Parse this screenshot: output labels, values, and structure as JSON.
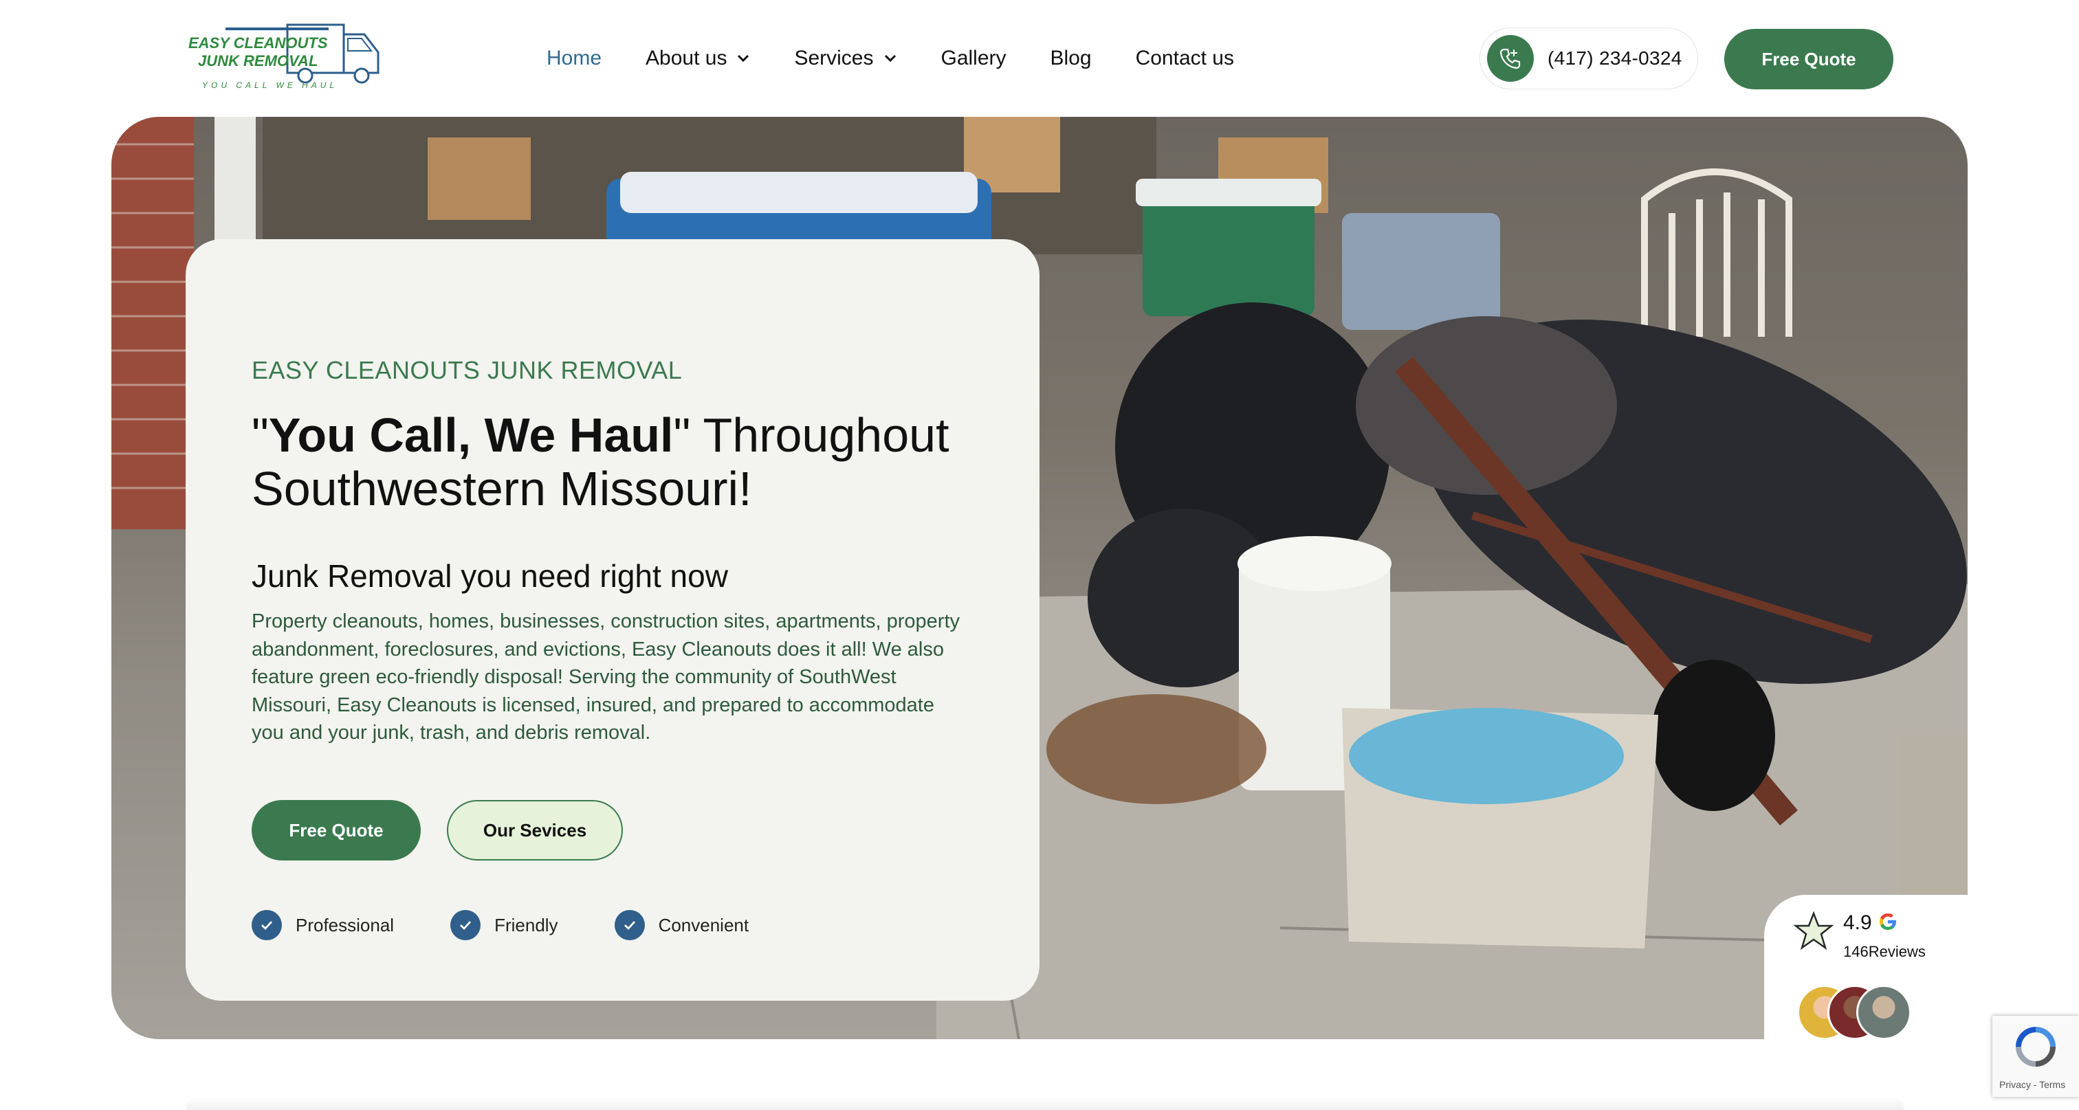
{
  "logo": {
    "line1": "EASY CLEANOUTS",
    "line2": "JUNK REMOVAL",
    "tagline": "YOU CALL WE HAUL"
  },
  "nav": {
    "items": [
      {
        "label": "Home",
        "active": true,
        "dropdown": false
      },
      {
        "label": "About us",
        "active": false,
        "dropdown": true
      },
      {
        "label": "Services",
        "active": false,
        "dropdown": true
      },
      {
        "label": "Gallery",
        "active": false,
        "dropdown": false
      },
      {
        "label": "Blog",
        "active": false,
        "dropdown": false
      },
      {
        "label": "Contact us",
        "active": false,
        "dropdown": false
      }
    ]
  },
  "header": {
    "phone": "(417) 234-0324",
    "phone_icon": "phone-icon",
    "quote_button": "Free Quote"
  },
  "hero": {
    "eyebrow": "EASY CLEANOUTS JUNK REMOVAL",
    "headline_quote_open": "\"",
    "headline_bold": "You Call, We Haul",
    "headline_rest": "\" Throughout Southwestern Missouri!",
    "subheading": "Junk Removal you need right now",
    "body": "Property cleanouts, homes, businesses, construction sites, apartments, property abandonment, foreclosures, and evictions, Easy Cleanouts does it all! We also feature green eco-friendly disposal! Serving the community of SouthWest Missouri, Easy Cleanouts is licensed, insured, and prepared to accommodate you and your junk, trash, and debris removal.",
    "primary_button": "Free Quote",
    "secondary_button": "Our Sevices",
    "features": [
      "Professional",
      "Friendly",
      "Convenient"
    ]
  },
  "reviews": {
    "rating": "4.9",
    "count_label": "146Reviews",
    "source_icon": "google-icon"
  },
  "recaptcha": {
    "terms": "Privacy - Terms"
  },
  "colors": {
    "brand_green": "#3b7a4f",
    "nav_active": "#2f6a8f",
    "check_blue": "#2f5f8a",
    "card_bg": "#f3f3ef"
  }
}
